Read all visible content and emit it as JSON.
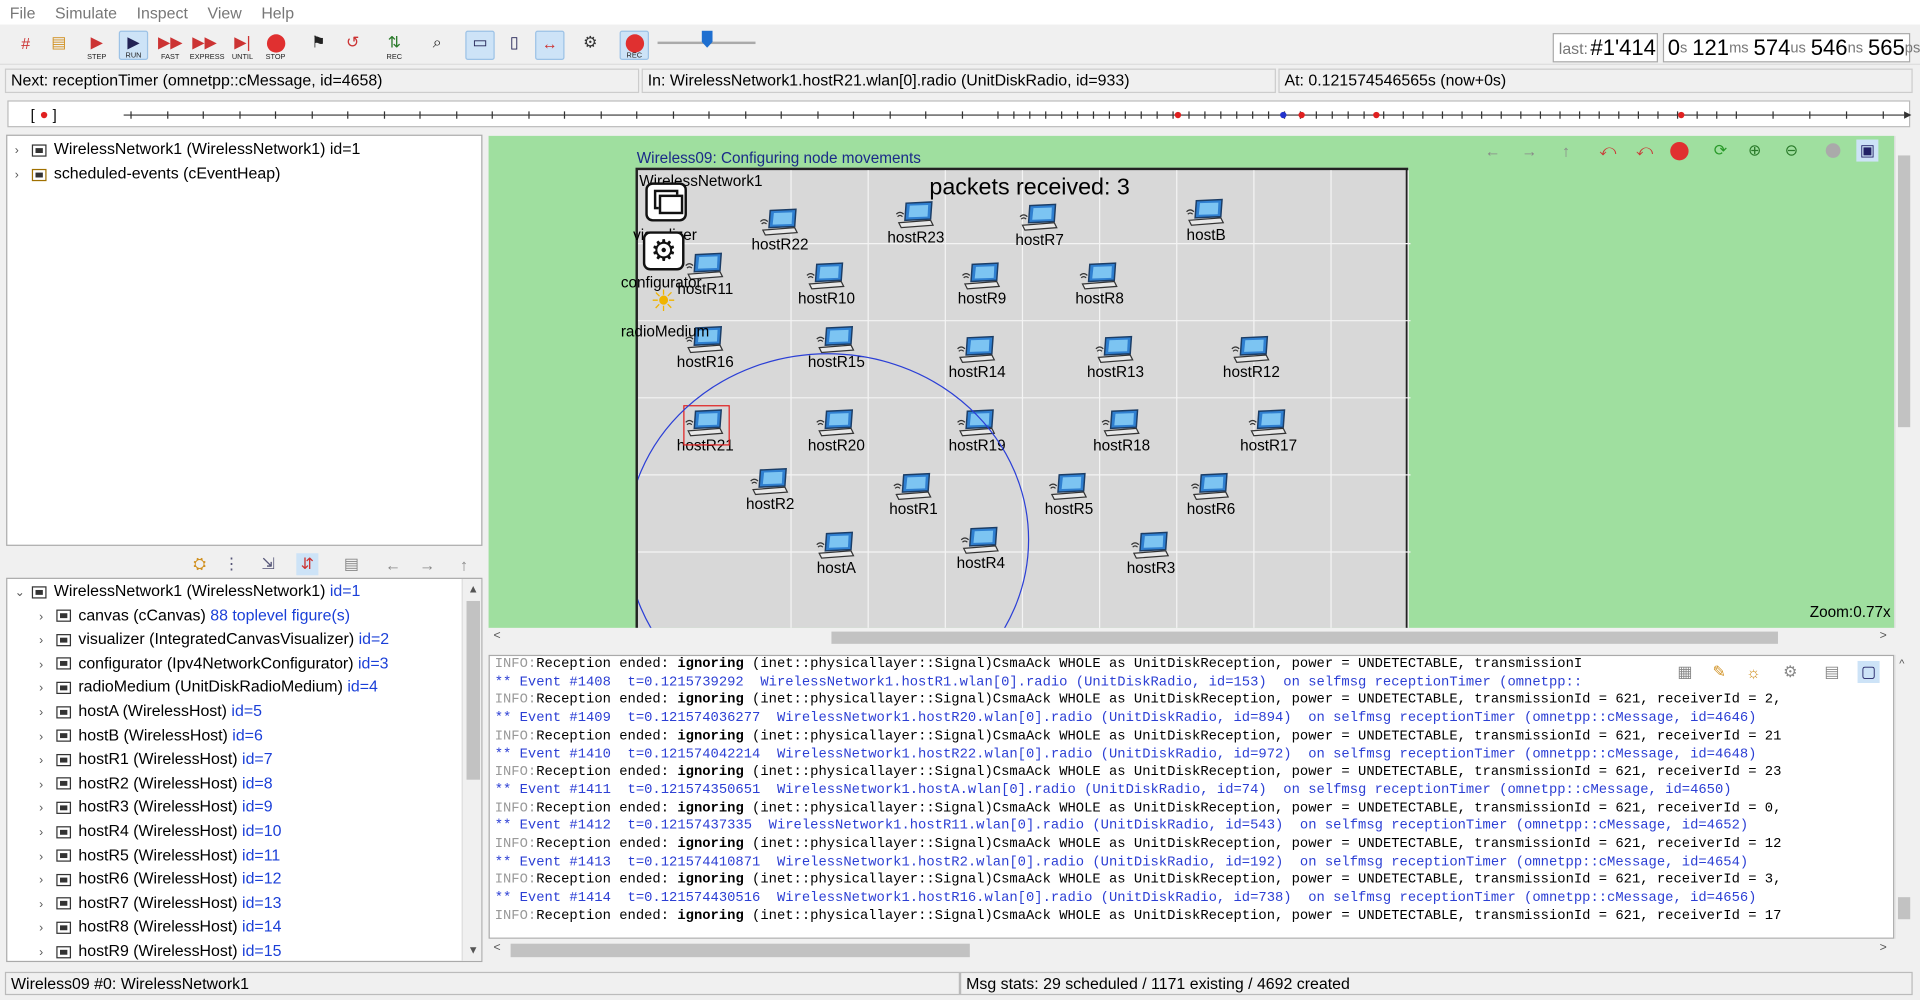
{
  "menu": [
    "File",
    "Simulate",
    "Inspect",
    "View",
    "Help"
  ],
  "toolbar": {
    "buttons": [
      {
        "name": "new-run-icon",
        "label": ""
      },
      {
        "name": "load-ned-icon",
        "label": ""
      },
      {
        "name": "step-button",
        "label": "STEP"
      },
      {
        "name": "run-button",
        "label": "RUN"
      },
      {
        "name": "fast-button",
        "label": "FAST"
      },
      {
        "name": "express-button",
        "label": "EXPRESS"
      },
      {
        "name": "until-button",
        "label": "UNTIL"
      },
      {
        "name": "stop-button",
        "label": "STOP"
      },
      {
        "name": "finish-button",
        "label": ""
      },
      {
        "name": "rebuild-button",
        "label": ""
      },
      {
        "name": "record-button",
        "label": "REC"
      },
      {
        "name": "find-button",
        "label": ""
      },
      {
        "name": "layout-horizontal-button",
        "label": ""
      },
      {
        "name": "layout-vertical-button",
        "label": ""
      },
      {
        "name": "timeline-toggle-button",
        "label": ""
      },
      {
        "name": "settings-button",
        "label": ""
      },
      {
        "name": "record-video-button",
        "label": "REC"
      }
    ],
    "last_label": "last:",
    "last_value": "#1'414",
    "time": {
      "s": "0",
      "ms": "121",
      "us": "574",
      "ns": "546",
      "ps": "565"
    },
    "speed_fraction": 0.5
  },
  "status": {
    "next": "Next: receptionTimer (omnetpp::cMessage, id=4658)",
    "in": "In: WirelessNetwork1.hostR21.wlan[0].radio (UnitDiskRadio, id=933)",
    "at": "At: 0.121574546565s (now+0s)"
  },
  "tree_top": [
    {
      "label": "WirelessNetwork1 (WirelessNetwork1) id=1",
      "icon": "module-icon"
    },
    {
      "label": "scheduled-events (cEventHeap)",
      "icon": "event-heap-icon"
    }
  ],
  "tree_bottom": [
    {
      "label": "WirelessNetwork1 (WirelessNetwork1)",
      "id": "id=1",
      "expanded": true,
      "indent": 0
    },
    {
      "label": "canvas (cCanvas)",
      "id": "88 toplevel figure(s)",
      "indent": 1
    },
    {
      "label": "visualizer (IntegratedCanvasVisualizer)",
      "id": "id=2",
      "indent": 1
    },
    {
      "label": "configurator (Ipv4NetworkConfigurator)",
      "id": "id=3",
      "indent": 1
    },
    {
      "label": "radioMedium (UnitDiskRadioMedium)",
      "id": "id=4",
      "indent": 1
    },
    {
      "label": "hostA (WirelessHost)",
      "id": "id=5",
      "indent": 1
    },
    {
      "label": "hostB (WirelessHost)",
      "id": "id=6",
      "indent": 1
    },
    {
      "label": "hostR1 (WirelessHost)",
      "id": "id=7",
      "indent": 1
    },
    {
      "label": "hostR2 (WirelessHost)",
      "id": "id=8",
      "indent": 1
    },
    {
      "label": "hostR3 (WirelessHost)",
      "id": "id=9",
      "indent": 1
    },
    {
      "label": "hostR4 (WirelessHost)",
      "id": "id=10",
      "indent": 1
    },
    {
      "label": "hostR5 (WirelessHost)",
      "id": "id=11",
      "indent": 1
    },
    {
      "label": "hostR6 (WirelessHost)",
      "id": "id=12",
      "indent": 1
    },
    {
      "label": "hostR7 (WirelessHost)",
      "id": "id=13",
      "indent": 1
    },
    {
      "label": "hostR8 (WirelessHost)",
      "id": "id=14",
      "indent": 1
    },
    {
      "label": "hostR9 (WirelessHost)",
      "id": "id=15",
      "indent": 1
    }
  ],
  "canvas": {
    "caption": "Wireless09: Configuring node movements",
    "network_label": "WirelessNetwork1",
    "packets_label": "packets received: 3",
    "zoom": "Zoom:0.77x",
    "visualizer_label": "visualizer",
    "configurator_label": "configurator",
    "radiomedium_label": "radioMedium",
    "hosts": [
      {
        "name": "hostR22"
      },
      {
        "name": "hostR23"
      },
      {
        "name": "hostR7"
      },
      {
        "name": "hostB"
      },
      {
        "name": "hostR11"
      },
      {
        "name": "hostR10"
      },
      {
        "name": "hostR9"
      },
      {
        "name": "hostR8"
      },
      {
        "name": "hostR16"
      },
      {
        "name": "hostR15"
      },
      {
        "name": "hostR14"
      },
      {
        "name": "hostR13"
      },
      {
        "name": "hostR12"
      },
      {
        "name": "hostR21"
      },
      {
        "name": "hostR20"
      },
      {
        "name": "hostR19"
      },
      {
        "name": "hostR18"
      },
      {
        "name": "hostR17"
      },
      {
        "name": "hostR2"
      },
      {
        "name": "hostR1"
      },
      {
        "name": "hostR5"
      },
      {
        "name": "hostR6"
      },
      {
        "name": "hostA"
      },
      {
        "name": "hostR4"
      },
      {
        "name": "hostR3"
      }
    ]
  },
  "log": [
    {
      "t": "info",
      "a": "INFO:",
      "b": "Reception ended: ",
      "c": "ignoring",
      "d": " (inet::physicallayer::Signal)CsmaAck WHOLE as UnitDiskReception, power = UNDETECTABLE, transmissionI"
    },
    {
      "t": "ev",
      "text": "** Event #1408  t=0.1215739292  WirelessNetwork1.hostR1.wlan[0].radio (UnitDiskRadio, id=153)  on selfmsg receptionTimer (omnetpp::"
    },
    {
      "t": "info",
      "a": "INFO:",
      "b": "Reception ended: ",
      "c": "ignoring",
      "d": " (inet::physicallayer::Signal)CsmaAck WHOLE as UnitDiskReception, power = UNDETECTABLE, transmissionId = 621, receiverId = 2,"
    },
    {
      "t": "ev",
      "text": "** Event #1409  t=0.121574036277  WirelessNetwork1.hostR20.wlan[0].radio (UnitDiskRadio, id=894)  on selfmsg receptionTimer (omnetpp::cMessage, id=4646)"
    },
    {
      "t": "info",
      "a": "INFO:",
      "b": "Reception ended: ",
      "c": "ignoring",
      "d": " (inet::physicallayer::Signal)CsmaAck WHOLE as UnitDiskReception, power = UNDETECTABLE, transmissionId = 621, receiverId = 21"
    },
    {
      "t": "ev",
      "text": "** Event #1410  t=0.121574042214  WirelessNetwork1.hostR22.wlan[0].radio (UnitDiskRadio, id=972)  on selfmsg receptionTimer (omnetpp::cMessage, id=4648)"
    },
    {
      "t": "info",
      "a": "INFO:",
      "b": "Reception ended: ",
      "c": "ignoring",
      "d": " (inet::physicallayer::Signal)CsmaAck WHOLE as UnitDiskReception, power = UNDETECTABLE, transmissionId = 621, receiverId = 23"
    },
    {
      "t": "ev",
      "text": "** Event #1411  t=0.121574350651  WirelessNetwork1.hostA.wlan[0].radio (UnitDiskRadio, id=74)  on selfmsg receptionTimer (omnetpp::cMessage, id=4650)"
    },
    {
      "t": "info",
      "a": "INFO:",
      "b": "Reception ended: ",
      "c": "ignoring",
      "d": " (inet::physicallayer::Signal)CsmaAck WHOLE as UnitDiskReception, power = UNDETECTABLE, transmissionId = 621, receiverId = 0,"
    },
    {
      "t": "ev",
      "text": "** Event #1412  t=0.12157437335  WirelessNetwork1.hostR11.wlan[0].radio (UnitDiskRadio, id=543)  on selfmsg receptionTimer (omnetpp::cMessage, id=4652)"
    },
    {
      "t": "info",
      "a": "INFO:",
      "b": "Reception ended: ",
      "c": "ignoring",
      "d": " (inet::physicallayer::Signal)CsmaAck WHOLE as UnitDiskReception, power = UNDETECTABLE, transmissionId = 621, receiverId = 12"
    },
    {
      "t": "ev",
      "text": "** Event #1413  t=0.121574410871  WirelessNetwork1.hostR2.wlan[0].radio (UnitDiskRadio, id=192)  on selfmsg receptionTimer (omnetpp::cMessage, id=4654)"
    },
    {
      "t": "info",
      "a": "INFO:",
      "b": "Reception ended: ",
      "c": "ignoring",
      "d": " (inet::physicallayer::Signal)CsmaAck WHOLE as UnitDiskReception, power = UNDETECTABLE, transmissionId = 621, receiverId = 3,"
    },
    {
      "t": "ev",
      "text": "** Event #1414  t=0.121574430516  WirelessNetwork1.hostR16.wlan[0].radio (UnitDiskRadio, id=738)  on selfmsg receptionTimer (omnetpp::cMessage, id=4656)"
    },
    {
      "t": "info",
      "a": "INFO:",
      "b": "Reception ended: ",
      "c": "ignoring",
      "d": " (inet::physicallayer::Signal)CsmaAck WHOLE as UnitDiskReception, power = UNDETECTABLE, transmissionId = 621, receiverId = 17"
    }
  ],
  "bottom_status": {
    "left": "Wireless09 #0: WirelessNetwork1",
    "right": "Msg stats: 29 scheduled / 1171 existing / 4692 created"
  },
  "colors": {
    "canvas_bg": "#9fdf9f",
    "event_blue": "#2c3fd4",
    "range_circle": "#2b3fd6",
    "selection": "#e02020"
  }
}
